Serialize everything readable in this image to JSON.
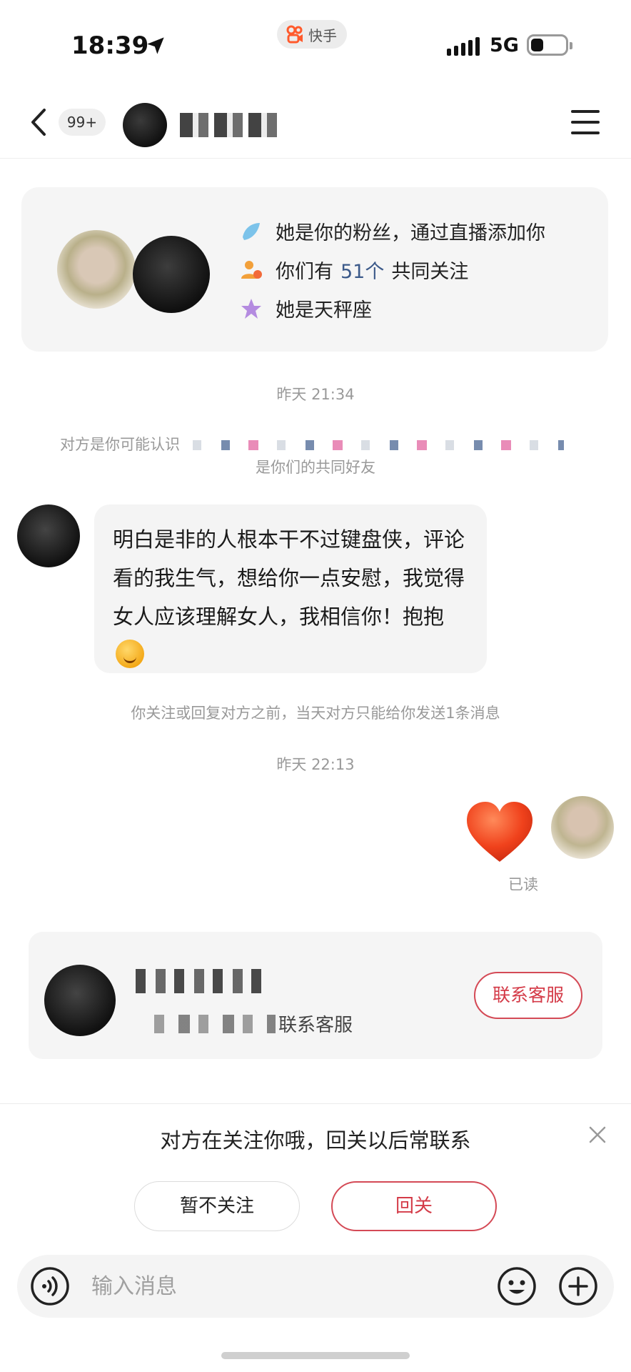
{
  "status_bar": {
    "time": "18:39",
    "app_name": "快手",
    "network": "5G"
  },
  "header": {
    "unread_badge": "99+"
  },
  "info_card": {
    "line1": "她是你的粉丝，通过直播添加你",
    "line2_prefix": "你们有",
    "line2_count": "51个",
    "line2_suffix": "共同关注",
    "line3": "她是天秤座",
    "icons": [
      "fan-icon",
      "mutual-follow-icon",
      "star-sign-icon"
    ]
  },
  "timestamps": {
    "first": "昨天 21:34",
    "second": "昨天 22:13"
  },
  "system_notes": {
    "may_know": "对方是你可能认识",
    "mutual_friend": "是你们的共同好友",
    "limit": "你关注或回复对方之前，当天对方只能给你发送1条消息"
  },
  "incoming_message": {
    "text": "明白是非的人根本干不过键盘侠，评论看的我生气，想给你一点安慰，我觉得女人应该理解女人，我相信你！抱抱"
  },
  "outgoing_message": {
    "emoji": "heart-emoji",
    "read_status": "已读"
  },
  "shop_card": {
    "subtitle": "联系客服",
    "contact_button": "联系客服"
  },
  "follow_prompt": {
    "text": "对方在关注你哦，回关以后常联系",
    "skip_button": "暂不关注",
    "follow_button": "回关"
  },
  "input": {
    "placeholder": "输入消息"
  },
  "colors": {
    "accent": "#d43b48",
    "highlight": "#3c5a8a",
    "bubble": "#f4f4f4",
    "muted": "#999999"
  }
}
